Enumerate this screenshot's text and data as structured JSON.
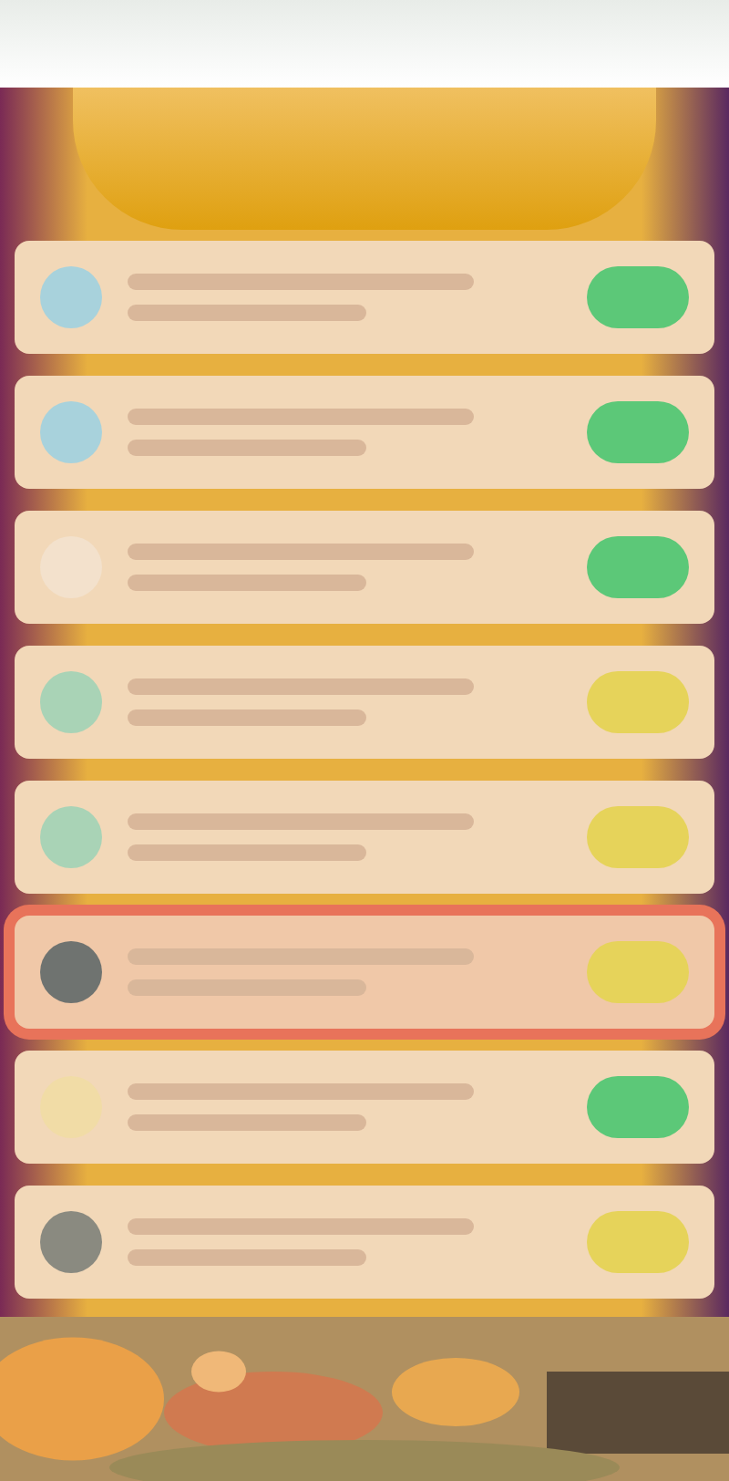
{
  "rows": [
    {
      "color": "#a8d2dc",
      "badge": {
        "color": "#5cc878"
      },
      "selected": false
    },
    {
      "color": "#a8d2dc",
      "badge": {
        "color": "#5cc878"
      },
      "selected": false
    },
    {
      "color": "#f3e1cc",
      "badge": {
        "color": "#5cc878"
      },
      "selected": false
    },
    {
      "color": "#a9d3b6",
      "badge": {
        "color": "#e6d35a"
      },
      "selected": false
    },
    {
      "color": "#a9d3b6",
      "badge": {
        "color": "#e6d35a"
      },
      "selected": false
    },
    {
      "color": "#6f7370",
      "badge": {
        "color": "#e6d35a"
      },
      "selected": true
    },
    {
      "color": "#f1dca6",
      "badge": {
        "color": "#5cc878"
      },
      "selected": false
    },
    {
      "color": "#8a8a80",
      "badge": {
        "color": "#e6d35a"
      },
      "selected": false
    }
  ]
}
